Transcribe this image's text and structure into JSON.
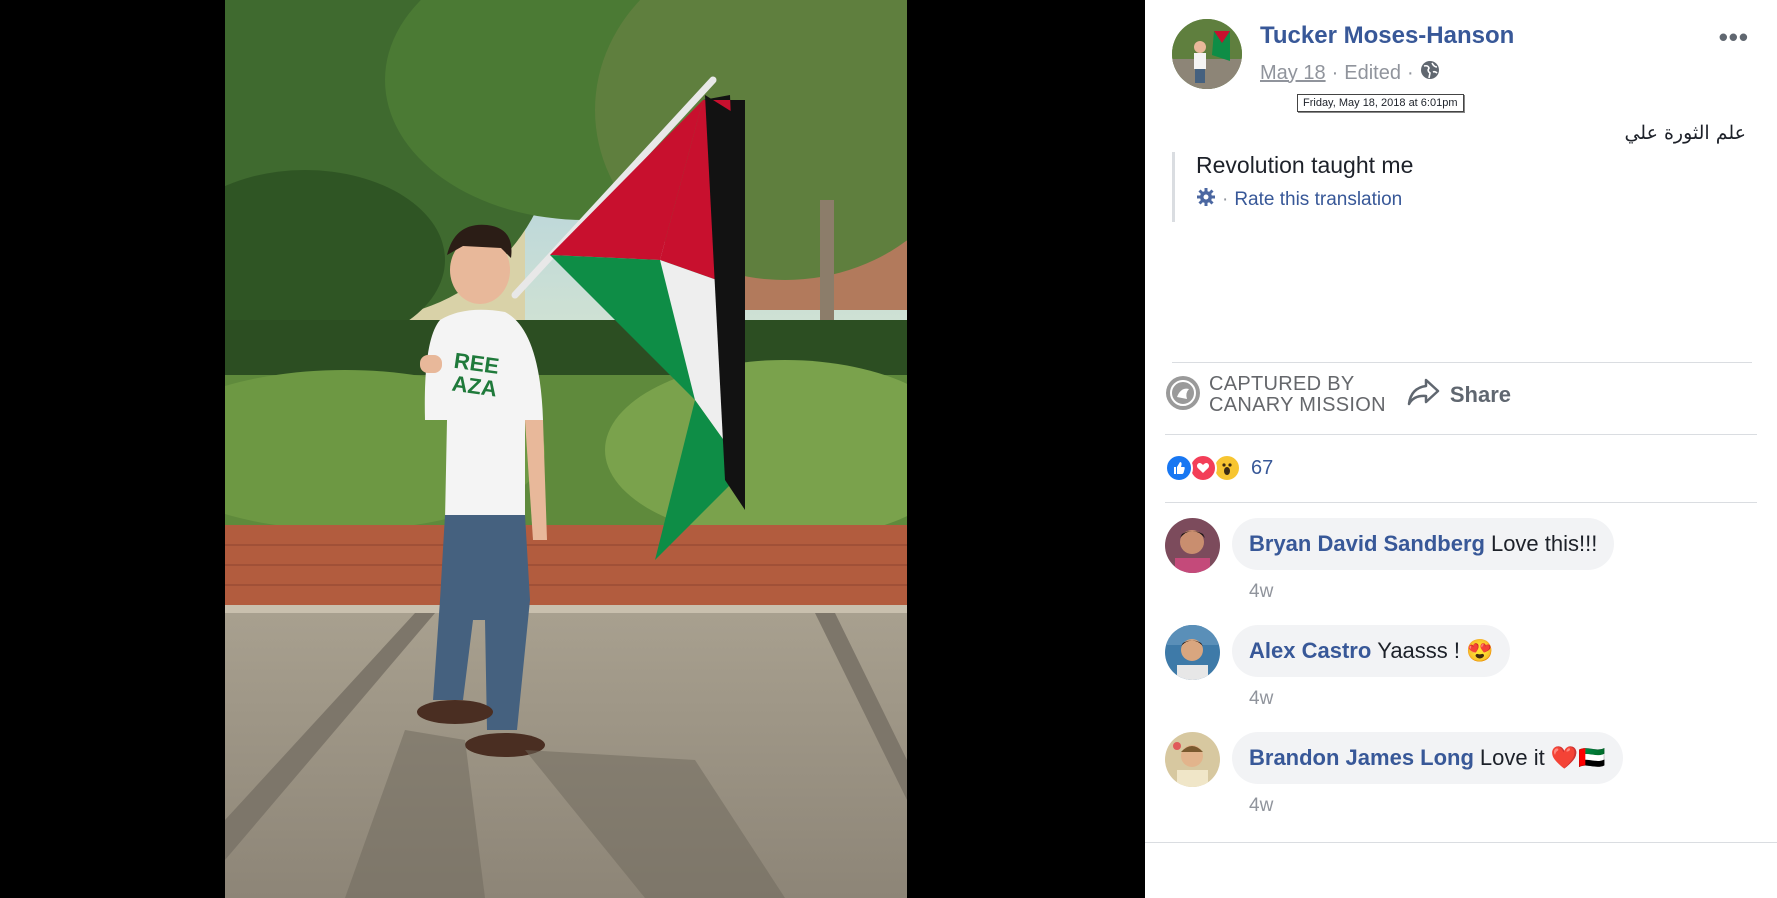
{
  "post": {
    "author": "Tucker Moses-Hanson",
    "date": "May 18",
    "edited": "Edited",
    "tooltip": "Friday, May 18, 2018 at 6:01pm",
    "more": "•••",
    "original_text": "علم الثورة علي",
    "translation": "Revolution taught me",
    "rate_translation": "Rate this translation"
  },
  "actions": {
    "captured_line1": "CAPTURED BY",
    "captured_line2": "CANARY MISSION",
    "share": "Share"
  },
  "reactions": {
    "count": "67",
    "types": [
      "like-icon",
      "love-icon",
      "wow-icon"
    ]
  },
  "comments": [
    {
      "name": "Bryan David Sandberg",
      "text": "Love this!!!",
      "time": "4w",
      "emoji": ""
    },
    {
      "name": "Alex Castro",
      "text": "Yaasss !",
      "time": "4w",
      "emoji": "😍"
    },
    {
      "name": "Brandon James Long",
      "text": "Love it",
      "time": "4w",
      "emoji": "❤️🇦🇪"
    }
  ],
  "colors": {
    "link": "#385898",
    "muted": "#90949c",
    "bubble": "#f2f3f5",
    "flag_red": "#c8102e",
    "flag_green": "#149954"
  }
}
